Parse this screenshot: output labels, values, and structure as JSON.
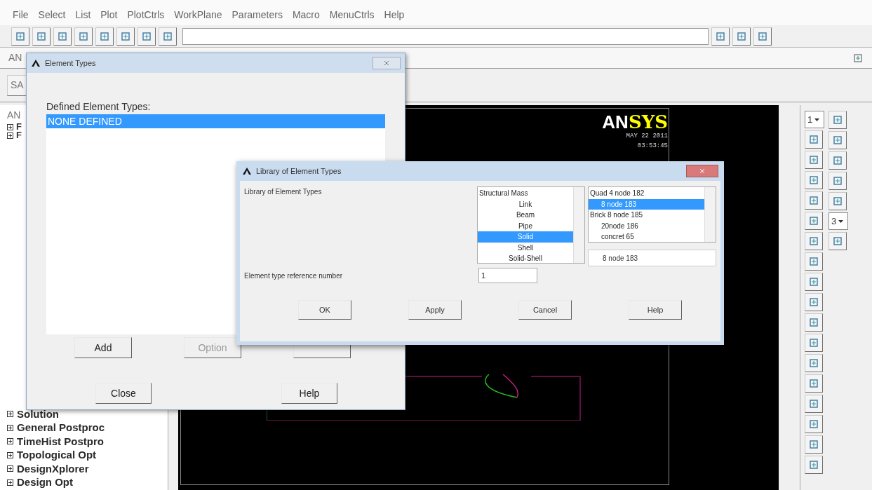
{
  "menu_bar": [
    "File",
    "Select",
    "List",
    "Plot",
    "PlotCtrls",
    "WorkPlane",
    "Parameters",
    "Macro",
    "MenuCtrls",
    "Help"
  ],
  "toolbar_label": "AN",
  "save_button": "SA",
  "main_menu": {
    "title": "AN",
    "top_items": [
      "F",
      "F"
    ],
    "bottom_items": [
      "Solution",
      "General Postproc",
      "TimeHist Postpro",
      "Topological Opt",
      "DesignXplorer",
      "Design Opt"
    ]
  },
  "graphics": {
    "logo_left": "AN",
    "logo_right": "SYS",
    "date": "MAY 22 2011",
    "time": "03:53:45"
  },
  "right_toolbar": {
    "view_number": "1",
    "zoom_factor": "3"
  },
  "element_types_dialog": {
    "title": "Element Types",
    "list_label": "Defined Element Types:",
    "items": [
      {
        "label": "NONE DEFINED",
        "selected": true
      }
    ],
    "buttons": [
      {
        "label": "Add",
        "disabled": false
      },
      {
        "label": "Option",
        "disabled": true
      }
    ],
    "bottom_buttons": [
      "Close",
      "Help"
    ]
  },
  "library_dialog": {
    "title": "Library of Element Types",
    "label": "Library of Element Types",
    "categories": [
      {
        "label": "Structural Mass",
        "kind": "group",
        "selected": false
      },
      {
        "label": "Link",
        "kind": "type",
        "selected": false
      },
      {
        "label": "Beam",
        "kind": "type",
        "selected": false
      },
      {
        "label": "Pipe",
        "kind": "type",
        "selected": false
      },
      {
        "label": "Solid",
        "kind": "type",
        "selected": true
      },
      {
        "label": "Shell",
        "kind": "type",
        "selected": false
      },
      {
        "label": "Solid-Shell",
        "kind": "type",
        "selected": false
      }
    ],
    "elements": [
      {
        "label": "Quad 4 node 182",
        "indented": false,
        "selected": false
      },
      {
        "label": "8 node 183",
        "indented": true,
        "selected": true
      },
      {
        "label": "Brick 8 node 185",
        "indented": false,
        "selected": false
      },
      {
        "label": "20node 186",
        "indented": true,
        "selected": false
      },
      {
        "label": "concret 65",
        "indented": true,
        "selected": false
      }
    ],
    "selection": "8 node 183",
    "ref_label": "Element type reference number",
    "ref_value": "1",
    "buttons": [
      "OK",
      "Apply",
      "Cancel",
      "Help"
    ]
  }
}
